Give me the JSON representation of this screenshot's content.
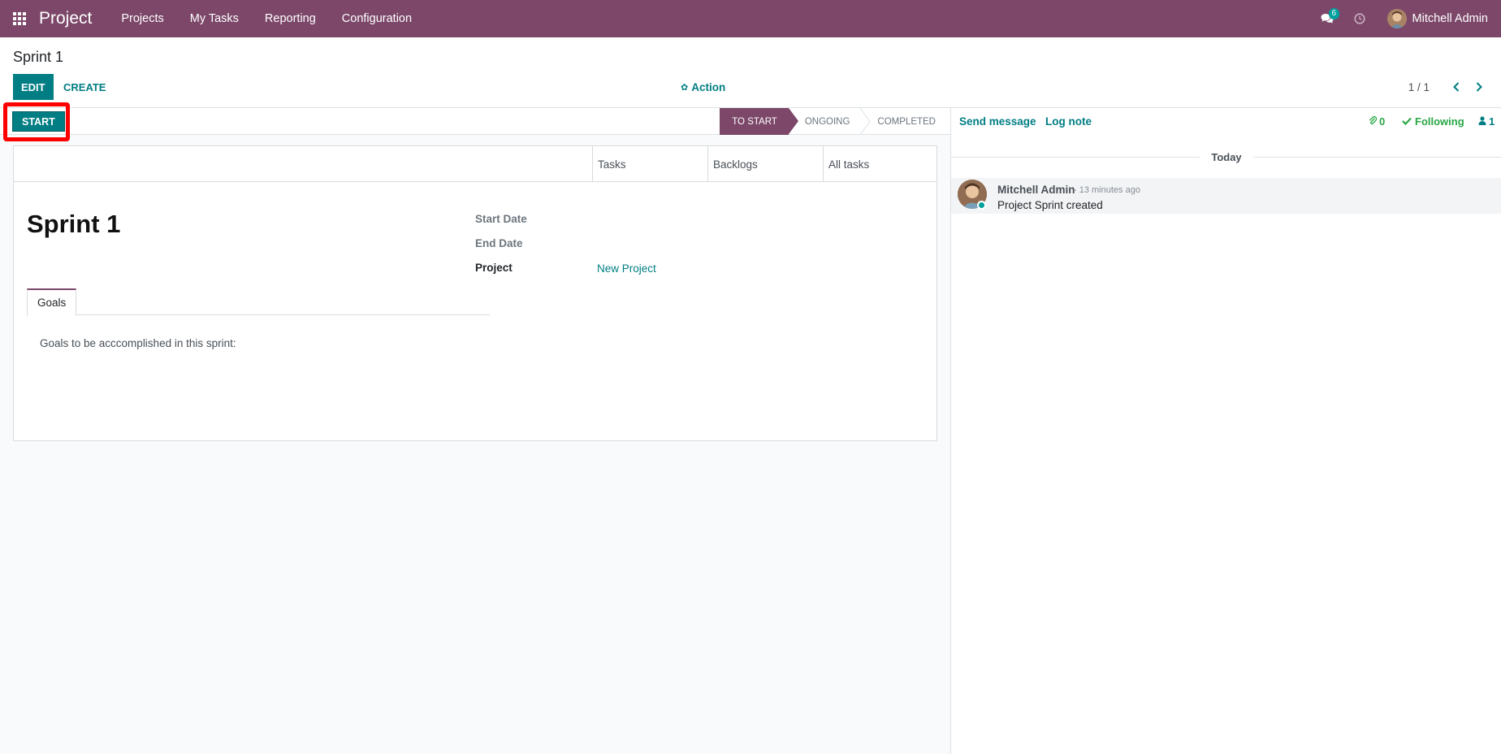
{
  "topbar": {
    "app_name": "Project",
    "menu": [
      "Projects",
      "My Tasks",
      "Reporting",
      "Configuration"
    ],
    "chat_count": "6",
    "user_name": "Mitchell Admin",
    "color": "#7c4769"
  },
  "control_panel": {
    "breadcrumb": "Sprint 1",
    "edit_label": "EDIT",
    "create_label": "CREATE",
    "action_label": "Action",
    "pager": "1 / 1"
  },
  "statusbar": {
    "start_label": "START",
    "stages": [
      {
        "label": "TO START",
        "active": true
      },
      {
        "label": "ONGOING",
        "active": false
      },
      {
        "label": "COMPLETED",
        "active": false
      }
    ]
  },
  "sheet": {
    "stat_buttons": [
      "Tasks",
      "Backlogs",
      "All tasks"
    ],
    "title": "Sprint 1",
    "fields": {
      "start_date_label": "Start Date",
      "end_date_label": "End Date",
      "project_label": "Project",
      "project_value": "New Project"
    },
    "tab_label": "Goals",
    "goals_text": "Goals to be acccomplished in this sprint:"
  },
  "chatter": {
    "send_message": "Send message",
    "log_note": "Log note",
    "attachments": "0",
    "following": "Following",
    "followers": "1",
    "today": "Today",
    "message": {
      "author": "Mitchell Admin",
      "date": "- 13 minutes ago",
      "body": "Project Sprint created"
    }
  },
  "colors": {
    "brand": "#7c4769",
    "accent": "#017e84",
    "highlight": "#ff0000"
  }
}
